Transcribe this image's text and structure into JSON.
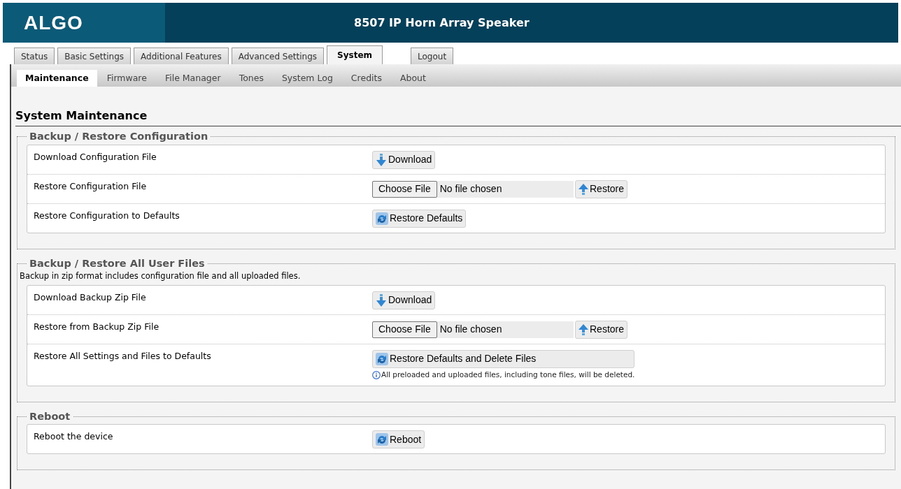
{
  "header": {
    "logo": "ALGO",
    "title": "8507 IP Horn Array Speaker"
  },
  "tabs": [
    {
      "label": "Status",
      "selected": false,
      "kind": "nav"
    },
    {
      "label": "Basic Settings",
      "selected": false,
      "kind": "nav"
    },
    {
      "label": "Additional Features",
      "selected": false,
      "kind": "nav"
    },
    {
      "label": "Advanced Settings",
      "selected": false,
      "kind": "nav"
    },
    {
      "label": "System",
      "selected": true,
      "kind": "nav"
    },
    {
      "label": "Logout",
      "selected": false,
      "kind": "logout"
    }
  ],
  "subtabs": [
    {
      "label": "Maintenance",
      "selected": true
    },
    {
      "label": "Firmware",
      "selected": false
    },
    {
      "label": "File Manager",
      "selected": false
    },
    {
      "label": "Tones",
      "selected": false
    },
    {
      "label": "System Log",
      "selected": false
    },
    {
      "label": "Credits",
      "selected": false
    },
    {
      "label": "About",
      "selected": false
    }
  ],
  "page_title": "System Maintenance",
  "sections": [
    {
      "legend": "Backup / Restore Configuration",
      "rows": [
        {
          "label": "Download Configuration File",
          "kind": "download",
          "button": "Download"
        },
        {
          "label": "Restore Configuration File",
          "kind": "file",
          "choose": "Choose File",
          "file_status": "No file chosen",
          "button": "Restore"
        },
        {
          "label": "Restore Configuration to Defaults",
          "kind": "reset",
          "button": "Restore Defaults"
        }
      ]
    },
    {
      "legend": "Backup / Restore All User Files",
      "description": "Backup in zip format includes configuration file and all uploaded files.",
      "rows": [
        {
          "label": "Download Backup Zip File",
          "kind": "download",
          "button": "Download"
        },
        {
          "label": "Restore from Backup Zip File",
          "kind": "file",
          "choose": "Choose File",
          "file_status": "No file chosen",
          "button": "Restore"
        },
        {
          "label": "Restore All Settings and Files to Defaults",
          "kind": "reset",
          "button": "Restore Defaults and Delete Files",
          "note": "All preloaded and uploaded files, including tone files, will be deleted."
        }
      ]
    },
    {
      "legend": "Reboot",
      "rows": [
        {
          "label": "Reboot the device",
          "kind": "reset",
          "button": "Reboot"
        }
      ]
    }
  ]
}
